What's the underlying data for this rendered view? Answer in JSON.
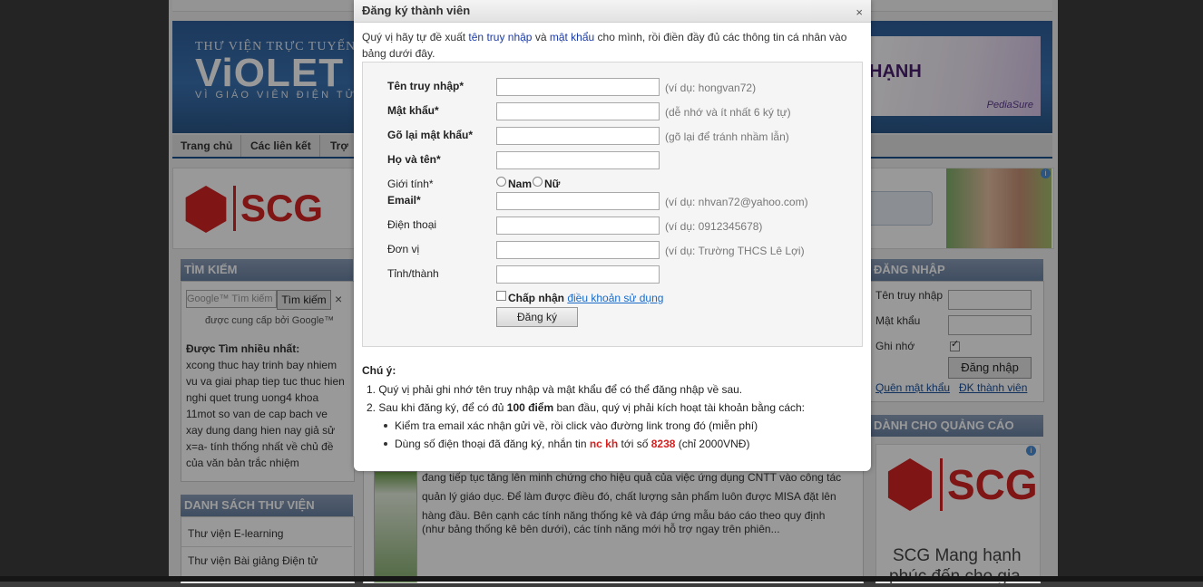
{
  "background": {
    "logo": {
      "small": "THƯ VIỆN TRỰC TUYẾN",
      "big": "ViOLET",
      "sub": "VÌ GIÁO VIÊN ĐIỆN TỬ"
    },
    "ad_banner": {
      "text": "HẠNH",
      "brand": "PediaSure"
    },
    "nav": [
      "Trang chủ",
      "Các liên kết",
      "Trợ"
    ],
    "scg": {
      "text": "SCG",
      "right_caption_1": "SCG Mang hạnh",
      "right_caption_2": "phúc đến cho gia"
    },
    "search_box": {
      "title": "TÌM KIẾM",
      "placeholder": "Google™ Tìm kiếm T",
      "button": "Tìm kiếm",
      "close": "×",
      "provided": "được cung cấp bởi Google™"
    },
    "most_searched": {
      "title": "Được Tìm nhiều nhất:",
      "lines": [
        "xcong thuc hay trinh bay nhiem",
        "vu va giai phap tiep tuc thuc hien",
        "nghi quet trung uong4 khoa",
        "11mot so van de cap bach ve",
        "xay dung dang hien nay giả sử",
        "x=a- tính thống nhất về chủ đề",
        "của văn bản trắc nhiệm"
      ]
    },
    "library_list": {
      "title": "DANH SÁCH THƯ VIỆN",
      "items": [
        "Thư viện E-learning",
        "Thư viện Bài giảng Điện tử"
      ]
    },
    "login": {
      "title": "ĐĂNG NHẬP",
      "username_label": "Tên truy nhập",
      "password_label": "Mật khẩu",
      "remember_label": "Ghi nhớ",
      "button": "Đăng nhập",
      "forgot": "Quên mật khẩu",
      "register": "ĐK thành viên"
    },
    "ads_box": {
      "title": "DÀNH CHO QUẢNG CÁO"
    },
    "article_lines": [
      "đang tiếp tục tăng lên minh chứng cho hiệu quả của việc ứng dụng CNTT vào công tác",
      "quản lý giáo dục. Để làm được điều đó, chất lượng sản phẩm luôn được MISA đặt lên",
      "hàng đầu. Bên cạnh các tính năng thống kê và đáp ứng mẫu báo cáo theo quy định",
      "(như bảng thống kê bên dưới), các tính năng mới hỗ trợ ngay trên phiên..."
    ]
  },
  "modal": {
    "title": "Đăng ký thành viên",
    "close": "×",
    "intro": {
      "pre": "Quý vị hãy tự đề xuất ",
      "link1": "tên truy nhập",
      "mid": " và ",
      "link2": "mật khẩu",
      "post": " cho mình, rồi điền đầy đủ các thông tin cá nhân vào",
      "line2": "bảng dưới đây."
    },
    "fields": [
      {
        "label": "Tên truy nhập*",
        "value": "",
        "hint": "(ví dụ: hongvan72)"
      },
      {
        "label": "Mật khẩu*",
        "value": "",
        "hint": "(dễ nhớ và ít nhất 6 ký tự)"
      },
      {
        "label": "Gõ lại mật khẩu*",
        "value": "",
        "hint": "(gõ lại để tránh nhầm lẫn)"
      },
      {
        "label": "Họ và tên*",
        "value": "",
        "hint": ""
      },
      {
        "label": "Email*",
        "value": "",
        "hint": "(ví dụ: nhvan72@yahoo.com)"
      },
      {
        "label": "Điện thoại",
        "value": "",
        "hint": "(ví dụ: 0912345678)"
      },
      {
        "label": "Đơn vị",
        "value": "",
        "hint": "(ví dụ: Trường THCS Lê Lợi)"
      },
      {
        "label": "Tỉnh/thành",
        "value": "",
        "hint": ""
      }
    ],
    "gender": {
      "label": "Giới tính*",
      "male": "Nam",
      "female": "Nữ"
    },
    "agree": {
      "text": "Chấp nhận ",
      "link": "điều khoản sử dụng"
    },
    "submit": "Đăng ký",
    "notes": {
      "title": "Chú ý:",
      "item1": "1. Quý vị phải ghi nhớ tên truy nhập và mật khẩu để có thể đăng nhập về sau.",
      "item2_pre": "2. Sau khi đăng ký, để có đủ ",
      "item2_bold": "100 điểm",
      "item2_post": " ban đầu, quý vị phải kích hoạt tài khoản bằng cách:",
      "sub1": "Kiểm tra email xác nhận gửi về, rồi click vào đường link trong đó (miễn phí)",
      "sub2_pre": "Dùng số điện thoại đã đăng ký, nhắn tin ",
      "sub2_code": "nc kh",
      "sub2_mid": " tới số ",
      "sub2_num": "8238",
      "sub2_post": " (chỉ 2000VNĐ)"
    }
  }
}
